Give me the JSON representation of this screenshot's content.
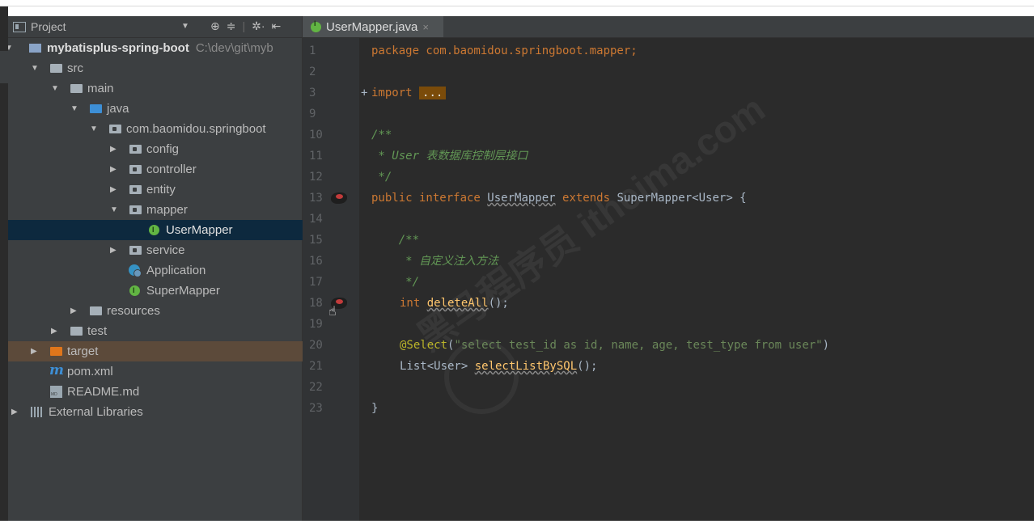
{
  "project_panel": {
    "title": "Project",
    "tool_icons": [
      "target-icon",
      "collapse-icon",
      "gear-icon",
      "hide-icon"
    ],
    "tree": [
      {
        "label": "mybatisplus-spring-boot",
        "path": "C:\\dev\\git\\myb",
        "icon": "module-icon",
        "expanded": true
      },
      {
        "label": "src",
        "icon": "folder-icon",
        "expanded": true
      },
      {
        "label": "main",
        "icon": "folder-icon",
        "expanded": true
      },
      {
        "label": "java",
        "icon": "source-folder-icon",
        "expanded": true
      },
      {
        "label": "com.baomidou.springboot",
        "icon": "package-icon",
        "expanded": true
      },
      {
        "label": "config",
        "icon": "package-icon",
        "expanded": false
      },
      {
        "label": "controller",
        "icon": "package-icon",
        "expanded": false
      },
      {
        "label": "entity",
        "icon": "package-icon",
        "expanded": false
      },
      {
        "label": "mapper",
        "icon": "package-icon",
        "expanded": true
      },
      {
        "label": "UserMapper",
        "icon": "interface-icon",
        "selected": true
      },
      {
        "label": "service",
        "icon": "package-icon",
        "expanded": false
      },
      {
        "label": "Application",
        "icon": "spring-boot-app-icon"
      },
      {
        "label": "SuperMapper",
        "icon": "interface-icon"
      },
      {
        "label": "resources",
        "icon": "resources-folder-icon",
        "expanded": false
      },
      {
        "label": "test",
        "icon": "folder-icon",
        "expanded": false
      },
      {
        "label": "target",
        "icon": "excluded-folder-icon",
        "expanded": false
      },
      {
        "label": "pom.xml",
        "icon": "maven-icon"
      },
      {
        "label": "README.md",
        "icon": "markdown-icon"
      },
      {
        "label": "External Libraries",
        "icon": "libraries-icon",
        "expanded": false
      }
    ]
  },
  "editor": {
    "tab": {
      "label": "UserMapper.java",
      "close": "×"
    },
    "lines": [
      {
        "n": "1",
        "text": "package com.baomidou.springboot.mapper;"
      },
      {
        "n": "2",
        "text": ""
      },
      {
        "n": "3",
        "kw": "import",
        "fold": "..."
      },
      {
        "n": "9",
        "text": ""
      },
      {
        "n": "10",
        "text": "/**"
      },
      {
        "n": "11",
        "text": " * User 表数据库控制层接口"
      },
      {
        "n": "12",
        "text": " */"
      },
      {
        "n": "13",
        "p1": "public interface ",
        "name": "UserMapper",
        "p2": " extends ",
        "sup": "SuperMapper<User>",
        "p3": " {"
      },
      {
        "n": "14",
        "text": ""
      },
      {
        "n": "15",
        "text": "    /**"
      },
      {
        "n": "16",
        "text": "     * 自定义注入方法"
      },
      {
        "n": "17",
        "text": "     */"
      },
      {
        "n": "18",
        "kw": "int ",
        "name": "deleteAll",
        "rest": "();"
      },
      {
        "n": "19",
        "text": ""
      },
      {
        "n": "20",
        "ann": "@Select",
        "p1": "(",
        "str": "\"select test_id as id, name, age, test_type from user\"",
        "p2": ")"
      },
      {
        "n": "21",
        "p1": "List<User> ",
        "name": "selectListBySQL",
        "rest": "();"
      },
      {
        "n": "22",
        "text": ""
      },
      {
        "n": "23",
        "text": "}"
      }
    ]
  },
  "watermark": "黑马程序员 itheima.com"
}
